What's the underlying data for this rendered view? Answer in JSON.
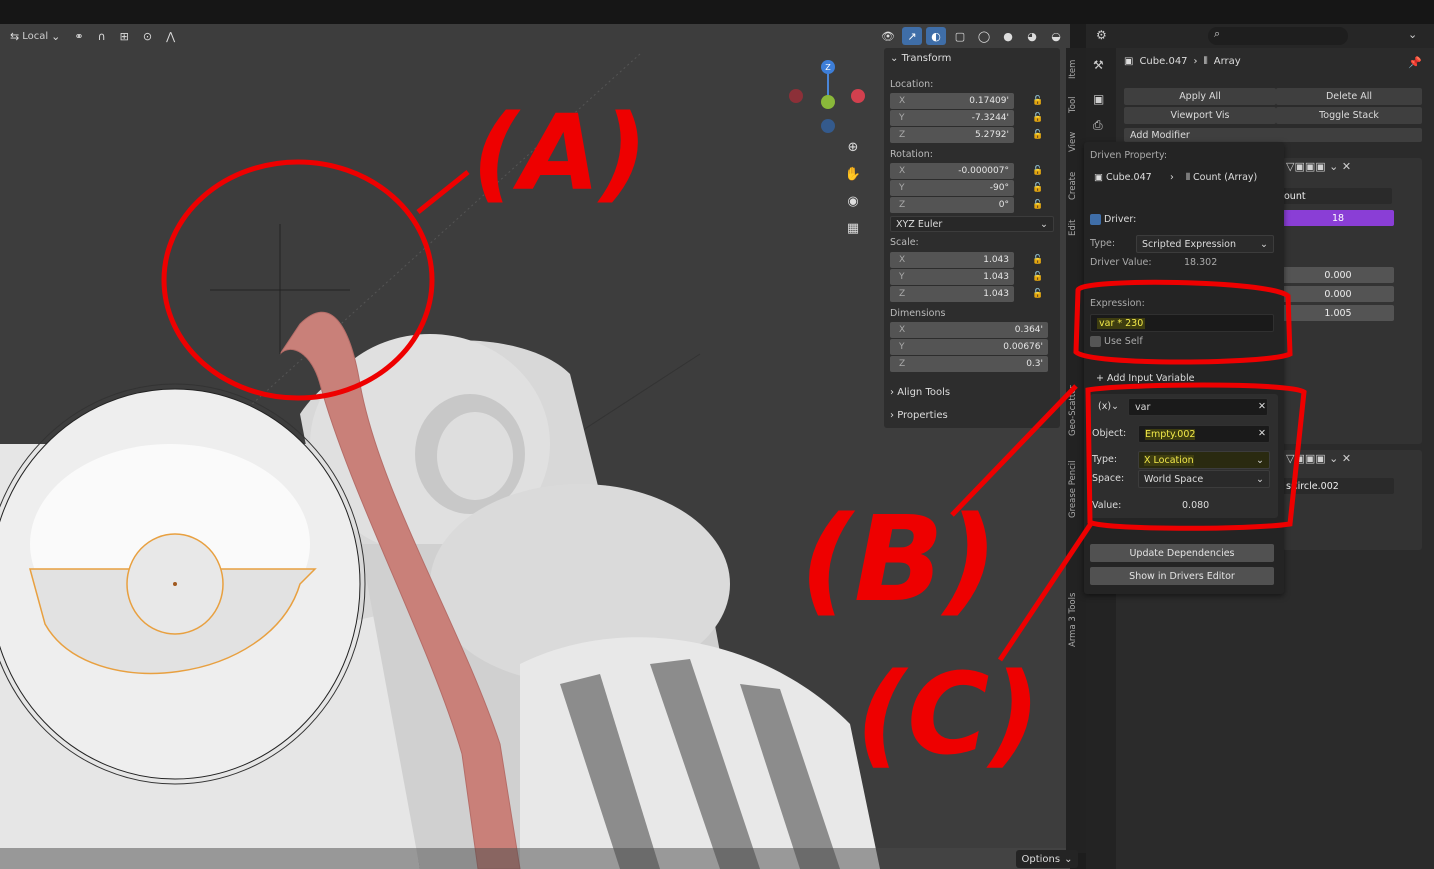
{
  "viewport": {
    "orientation_label": "Local",
    "options_label": "Options"
  },
  "npanel": {
    "title": "Transform",
    "location_label": "Location:",
    "location": [
      {
        "axis": "X",
        "value": "0.17409'"
      },
      {
        "axis": "Y",
        "value": "-7.3244'"
      },
      {
        "axis": "Z",
        "value": "5.2792'"
      }
    ],
    "rotation_label": "Rotation:",
    "rotation": [
      {
        "axis": "X",
        "value": "-0.000007°"
      },
      {
        "axis": "Y",
        "value": "-90°"
      },
      {
        "axis": "Z",
        "value": "0°"
      }
    ],
    "rotation_mode": "XYZ Euler",
    "scale_label": "Scale:",
    "scale": [
      {
        "axis": "X",
        "value": "1.043"
      },
      {
        "axis": "Y",
        "value": "1.043"
      },
      {
        "axis": "Z",
        "value": "1.043"
      }
    ],
    "dimensions_label": "Dimensions",
    "dimensions": [
      {
        "axis": "X",
        "value": "0.364'"
      },
      {
        "axis": "Y",
        "value": "0.00676'"
      },
      {
        "axis": "Z",
        "value": "0.3'"
      }
    ],
    "align_tools": "Align Tools",
    "properties": "Properties"
  },
  "vtabs": [
    "Item",
    "Tool",
    "View",
    "Create",
    "Edit",
    "Geo-Scatter",
    "Grease Pencil",
    "Arma 3 Tools"
  ],
  "props": {
    "crumb_object": "Cube.047",
    "crumb_modifier": "Array",
    "apply_all": "Apply All",
    "delete_all": "Delete All",
    "viewport_vis": "Viewport Vis",
    "toggle_stack": "Toggle Stack",
    "add_modifier": "Add Modifier",
    "count_label": "ount",
    "count_value": "18",
    "offset_values": [
      "0.000",
      "0.000",
      "1.005"
    ],
    "second_object": "sCircle.002"
  },
  "driver": {
    "driven_property_label": "Driven Property:",
    "driven_object": "Cube.047",
    "driven_path": "Count (Array)",
    "driver_checkbox": "Driver:",
    "type_label": "Type:",
    "type_value": "Scripted Expression",
    "driver_value_label": "Driver Value:",
    "driver_value": "18.302",
    "expression_label": "Expression:",
    "expression": "var * 230",
    "use_self": "Use Self",
    "add_input_variable": "Add Input Variable",
    "var_type_icon": "(x)",
    "var_name": "var",
    "object_label": "Object:",
    "object_value": "Empty.002",
    "var_type_label": "Type:",
    "var_type_value": "X Location",
    "space_label": "Space:",
    "space_value": "World Space",
    "value_label": "Value:",
    "value": "0.080",
    "update_dependencies": "Update Dependencies",
    "show_in_drivers_editor": "Show in Drivers Editor"
  },
  "annotations": {
    "a": "(A)",
    "b": "(B)",
    "c": "(C)",
    "color": "#ee0000"
  },
  "colors": {
    "accent_blue": "#3f6ea8",
    "highlight_yellow": "#f2e94a",
    "count_purple": "#8a3ed6"
  }
}
